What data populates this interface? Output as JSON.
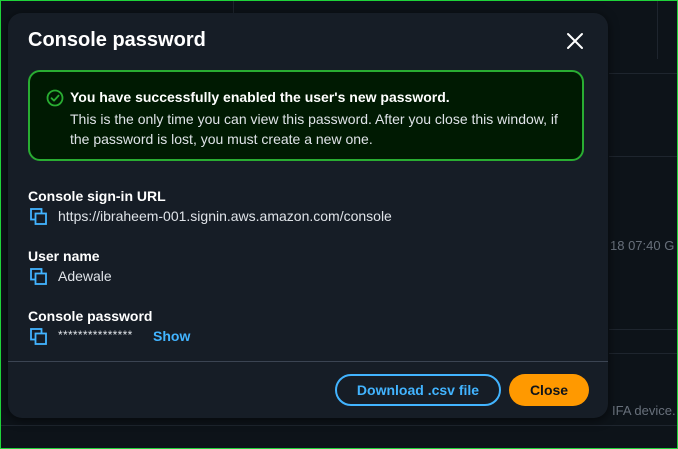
{
  "modal": {
    "title": "Console password",
    "alert": {
      "heading": "You have successfully enabled the user's new password.",
      "body": "This is the only time you can view this password. After you close this window, if the password is lost, you must create a new one."
    },
    "fields": [
      {
        "label": "Console sign-in URL",
        "value": "https://ibraheem-001.signin.aws.amazon.com/console"
      },
      {
        "label": "User name",
        "value": "Adewale"
      },
      {
        "label": "Console password",
        "value": "***************",
        "show_label": "Show"
      }
    ],
    "buttons": {
      "download_label": "Download .csv file",
      "close_label": "Close"
    },
    "icons": {
      "close": "close-icon",
      "status": "success-check-icon",
      "copy": "copy-icon"
    }
  },
  "background": {
    "timestamp_fragment": "18 07:40 G",
    "footer_fragment": "IFA device."
  },
  "colors": {
    "accent": "#42b4ff",
    "primary_button": "#ff9900",
    "success_border": "#29ad32",
    "success_bg": "#001a02",
    "modal_bg": "#161d26"
  }
}
